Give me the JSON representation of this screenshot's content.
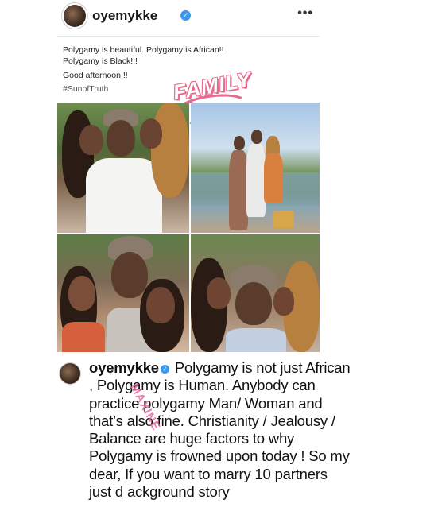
{
  "post": {
    "username": "oyemykke",
    "verified_mark": "✓",
    "more_icon": "•••"
  },
  "caption": {
    "line1": "Polygamy is beautiful. Polygamy is African!!",
    "line2": "Polygamy is Black!!!",
    "line3": "Good afternoon!!!",
    "hashtag": "#SunofTruth"
  },
  "stamp": {
    "text": "FAMILY",
    "color": "#e86a8c"
  },
  "comment": {
    "username": "oyemykke",
    "text": "Polygamy is not just African , Polygamy is Human. Anybody can practice polygamy Man/ Woman and that’s also fine. Christianity / Jealousy / Balance are huge factors to why Polygamy is frowned upon today ! So my dear, If you want to marry 10 partners just d ackground story"
  },
  "watermark": {
    "text": "MAXINE",
    "color": "#e46aa0"
  },
  "colors": {
    "verified": "#3897f0",
    "background": "#ffffff"
  }
}
